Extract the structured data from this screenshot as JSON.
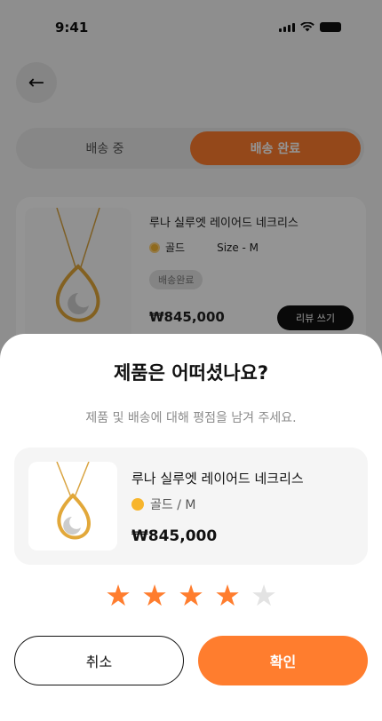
{
  "status_bar": {
    "time": "9:41"
  },
  "background": {
    "tabs": [
      {
        "label": "배송 중"
      },
      {
        "label": "배송 완료"
      }
    ],
    "order_card": {
      "name": "루나 실루엣 레이어드 네크리스",
      "color": "골드",
      "size": "Size - M",
      "status_chip": "배송완료",
      "price": "₩845,000",
      "action": "리뷰 쓰기"
    }
  },
  "sheet": {
    "title": "제품은 어떠셨나요?",
    "subtitle": "제품 및 배송에 대해 평점을 남겨 주세요.",
    "product": {
      "name": "루나 실루엣 레이어드 네크리스",
      "option": "골드 / M",
      "price": "₩845,000"
    },
    "rating": {
      "value": 4,
      "max": 5
    },
    "buttons": {
      "cancel": "취소",
      "confirm": "확인"
    }
  },
  "colors": {
    "accent": "#ff7d2e",
    "gold": "#f7b52c",
    "star_off": "#e3e3e3"
  },
  "icons": [
    "back-arrow-icon",
    "signal-icon",
    "wifi-icon",
    "battery-icon",
    "star-icon",
    "necklace-image"
  ]
}
